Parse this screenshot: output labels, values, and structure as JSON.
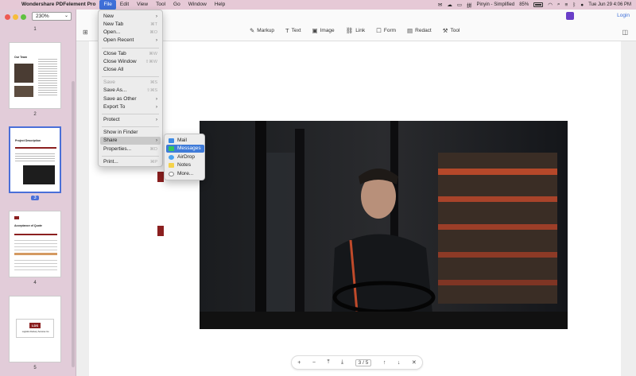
{
  "menubar": {
    "app_name": "Wondershare PDFelement Pro",
    "items": [
      "File",
      "Edit",
      "View",
      "Tool",
      "Go",
      "Window",
      "Help"
    ],
    "input_source": "Pinyin - Simplified",
    "battery": "85%",
    "clock": "Tue Jun 29  4:06 PM"
  },
  "sidebar": {
    "zoom": "230%",
    "pages": [
      {
        "number": "1"
      },
      {
        "number": "2",
        "heading": "Our Team"
      },
      {
        "number": "3",
        "heading": "Project Description"
      },
      {
        "number": "4",
        "heading": "Acceptance of Quote"
      },
      {
        "number": "5",
        "logo": "LDS",
        "caption": "Logistics Delivery Services Inc."
      }
    ]
  },
  "toolbar": {
    "tools": [
      {
        "label": "Markup",
        "icon": "pen-icon"
      },
      {
        "label": "Text",
        "icon": "text-icon"
      },
      {
        "label": "Image",
        "icon": "image-icon"
      },
      {
        "label": "Link",
        "icon": "link-icon"
      },
      {
        "label": "Form",
        "icon": "form-icon"
      },
      {
        "label": "Redact",
        "icon": "redact-icon"
      },
      {
        "label": "Tool",
        "icon": "toolbox-icon"
      }
    ],
    "login": "Login"
  },
  "file_menu": {
    "items": [
      {
        "label": "New",
        "shortcut": "",
        "submenu": true
      },
      {
        "label": "New Tab",
        "shortcut": "⌘T"
      },
      {
        "label": "Open...",
        "shortcut": "⌘O"
      },
      {
        "label": "Open Recent",
        "shortcut": "",
        "submenu": true
      },
      {
        "label": "Close Tab",
        "shortcut": "⌘W"
      },
      {
        "label": "Close Window",
        "shortcut": "⇧⌘W"
      },
      {
        "label": "Close All",
        "shortcut": ""
      },
      {
        "label": "Save",
        "shortcut": "⌘S",
        "disabled": true
      },
      {
        "label": "Save As...",
        "shortcut": "⇧⌘S"
      },
      {
        "label": "Save as Other",
        "shortcut": "",
        "submenu": true
      },
      {
        "label": "Export To",
        "shortcut": "",
        "submenu": true
      },
      {
        "label": "Protect",
        "shortcut": "",
        "submenu": true
      },
      {
        "label": "Show in Finder",
        "shortcut": ""
      },
      {
        "label": "Share",
        "shortcut": "",
        "submenu": true,
        "highlighted": true
      },
      {
        "label": "Properties...",
        "shortcut": "⌘D"
      },
      {
        "label": "Print...",
        "shortcut": "⌘P"
      }
    ]
  },
  "share_menu": {
    "items": [
      {
        "label": "Mail",
        "icon": "mail-icon"
      },
      {
        "label": "Messages",
        "icon": "messages-icon",
        "highlighted": true
      },
      {
        "label": "AirDrop",
        "icon": "airdrop-icon"
      },
      {
        "label": "Notes",
        "icon": "notes-icon"
      },
      {
        "label": "More...",
        "icon": "more-icon"
      }
    ]
  },
  "pagenav": {
    "current": "3",
    "separator": "/",
    "total": "5"
  },
  "colors": {
    "accent": "#3f7bd9",
    "menubar_bg": "#e6c9d6",
    "sidebar_bg": "#e2ccd9",
    "page_red": "#8b1f1f"
  }
}
